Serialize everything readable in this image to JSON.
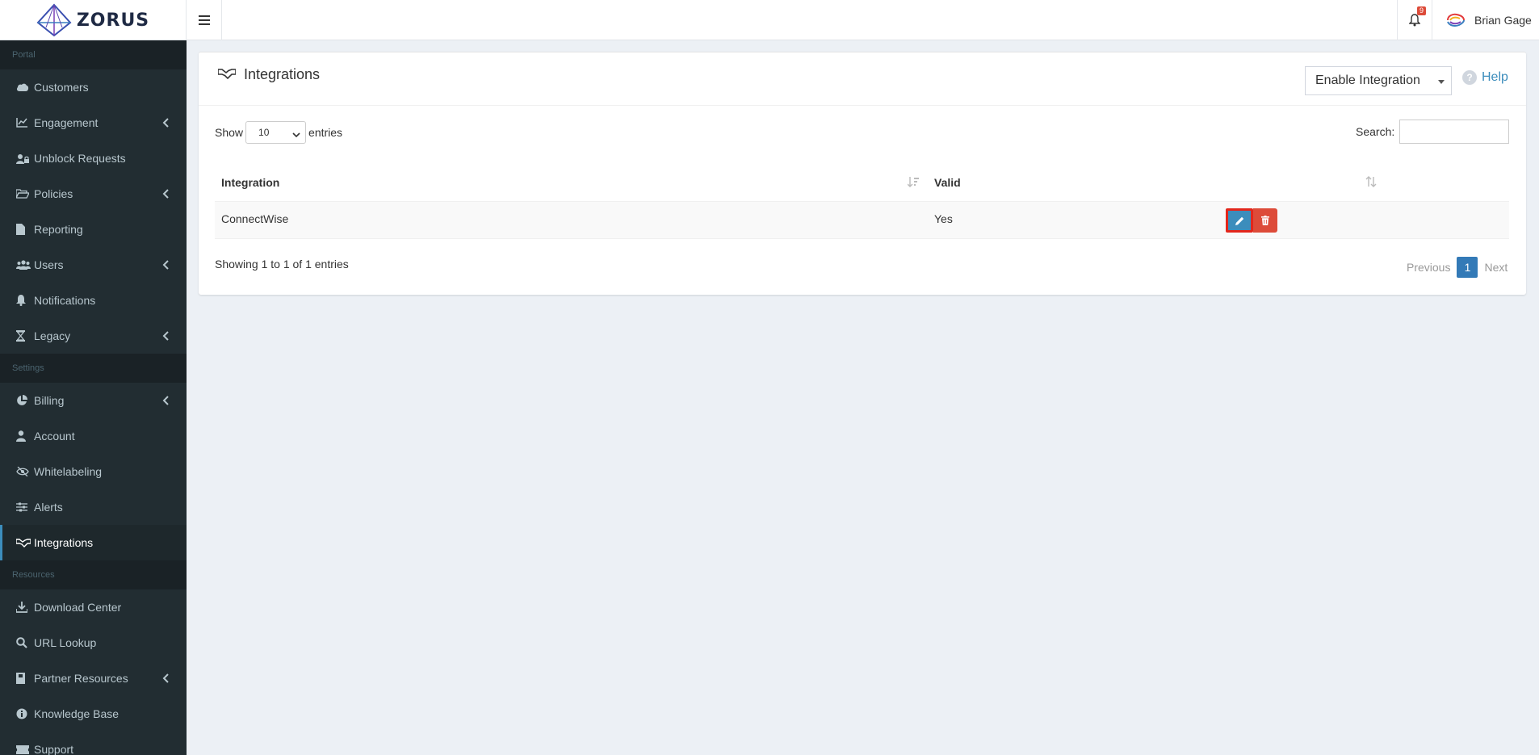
{
  "brand": {
    "name": "ZORUS"
  },
  "header": {
    "notifications_count": "9",
    "user_name": "Brian Gage"
  },
  "sidebar": {
    "sections": [
      {
        "label": "Portal"
      },
      {
        "label": "Settings"
      },
      {
        "label": "Resources"
      }
    ],
    "items": [
      {
        "label": "Customers",
        "icon": "cloud-icon"
      },
      {
        "label": "Engagement",
        "icon": "chart-line-icon"
      },
      {
        "label": "Unblock Requests",
        "icon": "user-lock-icon"
      },
      {
        "label": "Policies",
        "icon": "folder-open-icon"
      },
      {
        "label": "Reporting",
        "icon": "file-icon"
      },
      {
        "label": "Users",
        "icon": "users-icon"
      },
      {
        "label": "Notifications",
        "icon": "bell-icon"
      },
      {
        "label": "Legacy",
        "icon": "hourglass-icon"
      },
      {
        "label": "Billing",
        "icon": "pie-chart-icon"
      },
      {
        "label": "Account",
        "icon": "user-icon"
      },
      {
        "label": "Whitelabeling",
        "icon": "eye-slash-icon"
      },
      {
        "label": "Alerts",
        "icon": "sliders-icon"
      },
      {
        "label": "Integrations",
        "icon": "handshake-icon"
      },
      {
        "label": "Download Center",
        "icon": "download-icon"
      },
      {
        "label": "URL Lookup",
        "icon": "search-icon"
      },
      {
        "label": "Partner Resources",
        "icon": "book-icon"
      },
      {
        "label": "Knowledge Base",
        "icon": "info-circle-icon"
      },
      {
        "label": "Support",
        "icon": "ticket-icon"
      }
    ]
  },
  "page": {
    "title": "Integrations",
    "enable_select": "Enable Integration",
    "help": "Help",
    "show_label": "Show",
    "entries_label": "entries",
    "page_length": "10",
    "search_label": "Search:",
    "columns": [
      "Integration",
      "Valid"
    ],
    "rows": [
      {
        "integration": "ConnectWise",
        "valid": "Yes"
      }
    ],
    "info": "Showing 1 to 1 of 1 entries",
    "pagination": {
      "previous": "Previous",
      "current": "1",
      "next": "Next"
    }
  },
  "colors": {
    "sidebar_bg": "#222d32",
    "accent": "#3c8dbc",
    "danger": "#dd4b39",
    "highlight": "#e3261b"
  }
}
